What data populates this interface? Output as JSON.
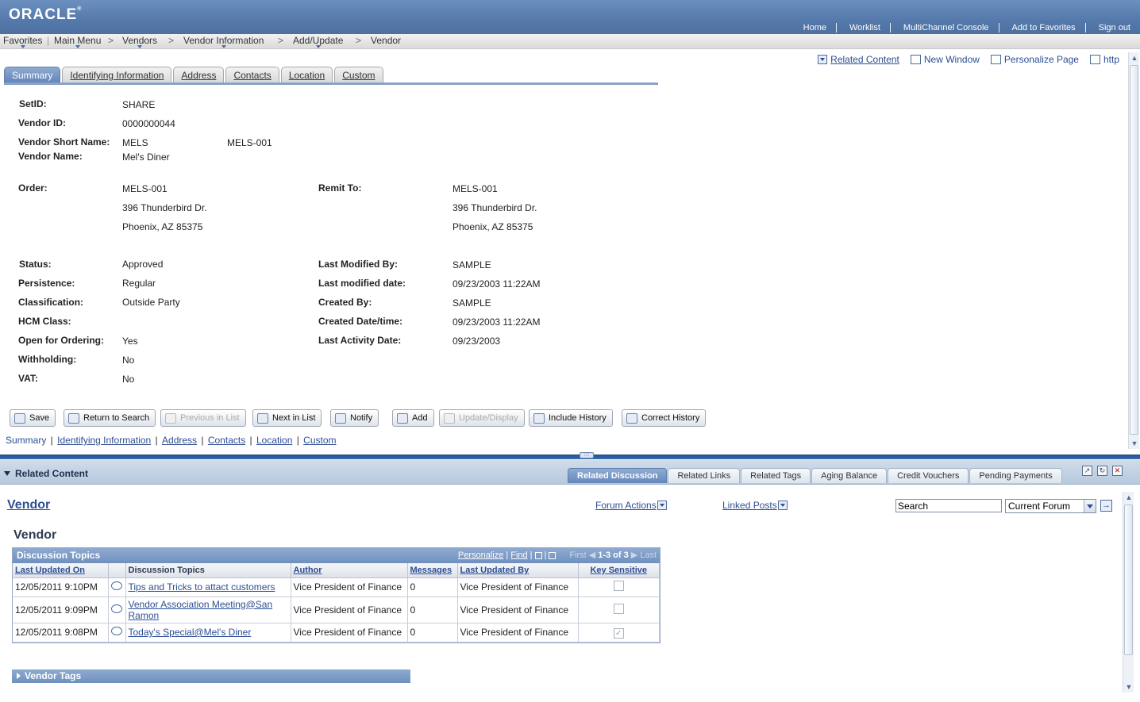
{
  "header": {
    "logo": "ORACLE",
    "links": [
      "Home",
      "Worklist",
      "MultiChannel Console",
      "Add to Favorites",
      "Sign out"
    ]
  },
  "nav": {
    "items": [
      "Favorites",
      "Main Menu",
      "Vendors",
      "Vendor Information",
      "Add/Update",
      "Vendor"
    ],
    "separator": ">"
  },
  "page_actions": {
    "related_content": "Related Content",
    "new_window": "New Window",
    "personalize_page": "Personalize Page",
    "http": "http"
  },
  "tabs": [
    "Summary",
    "Identifying Information",
    "Address",
    "Contacts",
    "Location",
    "Custom"
  ],
  "fields": {
    "setid_label": "SetID:",
    "setid": "SHARE",
    "vendor_id_label": "Vendor ID:",
    "vendor_id": "0000000044",
    "short_name_label": "Vendor Short Name:",
    "short_name": "MELS",
    "short_name2": "MELS-001",
    "vendor_name_label": "Vendor Name:",
    "vendor_name": "Mel's Diner",
    "order_label": "Order:",
    "order_lines": [
      "MELS-001",
      "396 Thunderbird Dr.",
      "Phoenix, AZ  85375"
    ],
    "remit_label": "Remit To:",
    "remit_lines": [
      "MELS-001",
      "396 Thunderbird Dr.",
      "Phoenix, AZ  85375"
    ],
    "status_label": "Status:",
    "status": "Approved",
    "persistence_label": "Persistence:",
    "persistence": "Regular",
    "classification_label": "Classification:",
    "classification": "Outside Party",
    "hcm_label": "HCM Class:",
    "open_ordering_label": "Open for Ordering:",
    "open_ordering": "Yes",
    "withholding_label": "Withholding:",
    "withholding": "No",
    "vat_label": "VAT:",
    "vat": "No",
    "last_mod_by_label": "Last Modified By:",
    "last_mod_by": "SAMPLE",
    "last_mod_date_label": "Last modified date:",
    "last_mod_date": "09/23/2003 11:22AM",
    "created_by_label": "Created By:",
    "created_by": "SAMPLE",
    "created_dt_label": "Created Date/time:",
    "created_dt": "09/23/2003 11:22AM",
    "last_activity_label": "Last Activity Date:",
    "last_activity": "09/23/2003"
  },
  "buttons": {
    "save": "Save",
    "return_search": "Return to Search",
    "previous": "Previous in List",
    "next": "Next in List",
    "notify": "Notify",
    "add": "Add",
    "update_display": "Update/Display",
    "include_history": "Include History",
    "correct_history": "Correct History"
  },
  "bottom_links": [
    "Summary",
    "Identifying Information",
    "Address",
    "Contacts",
    "Location",
    "Custom"
  ],
  "related": {
    "title": "Related Content",
    "tabs": [
      "Related Discussion",
      "Related Links",
      "Related Tags",
      "Aging Balance",
      "Credit Vouchers",
      "Pending Payments"
    ],
    "vendor_link": "Vendor",
    "forum_actions": "Forum Actions",
    "linked_posts": "Linked Posts",
    "search_value": "Search",
    "forum_select": "Current Forum",
    "section_title": "Vendor",
    "grid": {
      "title": "Discussion Topics",
      "personalize": "Personalize",
      "find": "Find",
      "first": "First",
      "range": "1-3 of 3",
      "last": "Last",
      "columns": [
        "Last Updated On",
        "",
        "Discussion Topics",
        "Author",
        "Messages",
        "Last Updated By",
        "Key Sensitive"
      ],
      "rows": [
        {
          "updated": "12/05/2011  9:10PM",
          "topic": "Tips and Tricks to attact customers",
          "author": "Vice President of Finance",
          "messages": "0",
          "updated_by": "Vice President of Finance",
          "key": false
        },
        {
          "updated": "12/05/2011  9:09PM",
          "topic": "Vendor Association Meeting@San Ramon",
          "author": "Vice President of Finance",
          "messages": "0",
          "updated_by": "Vice President of Finance",
          "key": false
        },
        {
          "updated": "12/05/2011  9:08PM",
          "topic": "Today's Special@Mel's Diner",
          "author": "Vice President of Finance",
          "messages": "0",
          "updated_by": "Vice President of Finance",
          "key": true
        }
      ]
    },
    "vendor_tags": "Vendor Tags"
  }
}
